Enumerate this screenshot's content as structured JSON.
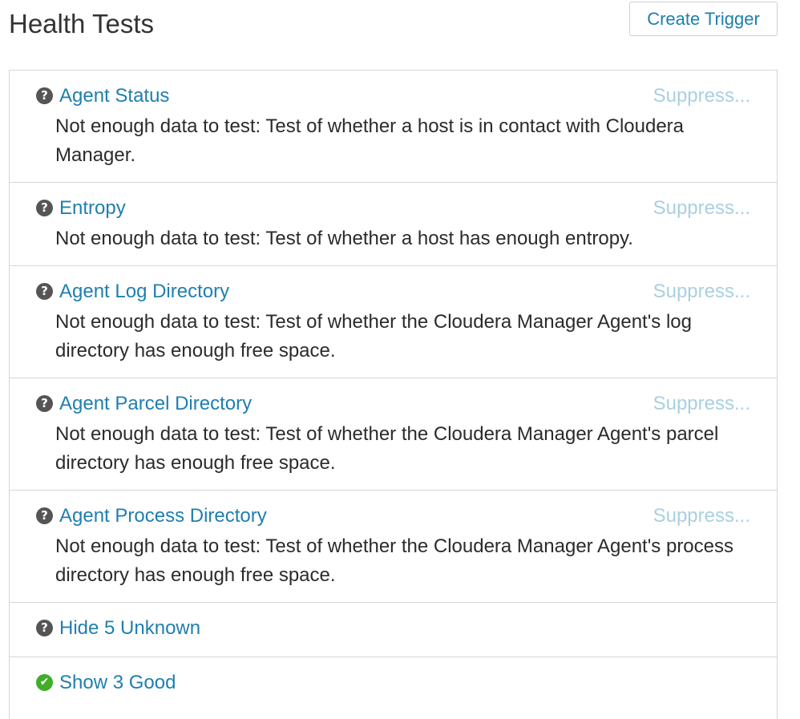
{
  "header": {
    "title": "Health Tests",
    "create_trigger_label": "Create Trigger"
  },
  "tests": [
    {
      "name": "Agent Status",
      "status_icon": "question-circle-icon",
      "suppress_label": "Suppress...",
      "description": "Not enough data to test: Test of whether a host is in contact with Cloudera Manager."
    },
    {
      "name": "Entropy",
      "status_icon": "question-circle-icon",
      "suppress_label": "Suppress...",
      "description": "Not enough data to test: Test of whether a host has enough entropy."
    },
    {
      "name": "Agent Log Directory",
      "status_icon": "question-circle-icon",
      "suppress_label": "Suppress...",
      "description": "Not enough data to test: Test of whether the Cloudera Manager Agent's log directory has enough free space."
    },
    {
      "name": "Agent Parcel Directory",
      "status_icon": "question-circle-icon",
      "suppress_label": "Suppress...",
      "description": "Not enough data to test: Test of whether the Cloudera Manager Agent's parcel directory has enough free space."
    },
    {
      "name": "Agent Process Directory",
      "status_icon": "question-circle-icon",
      "suppress_label": "Suppress...",
      "description": "Not enough data to test: Test of whether the Cloudera Manager Agent's process directory has enough free space."
    }
  ],
  "toggles": {
    "unknown": {
      "label": "Hide 5 Unknown",
      "icon": "question-circle-icon"
    },
    "good": {
      "label": "Show 3 Good",
      "icon": "check-circle-icon"
    }
  },
  "colors": {
    "link": "#1f7fae",
    "suppress": "#a9d0e2",
    "unknown_icon": "#555555",
    "good_icon": "#3fae29",
    "border": "#d6d6d6"
  }
}
